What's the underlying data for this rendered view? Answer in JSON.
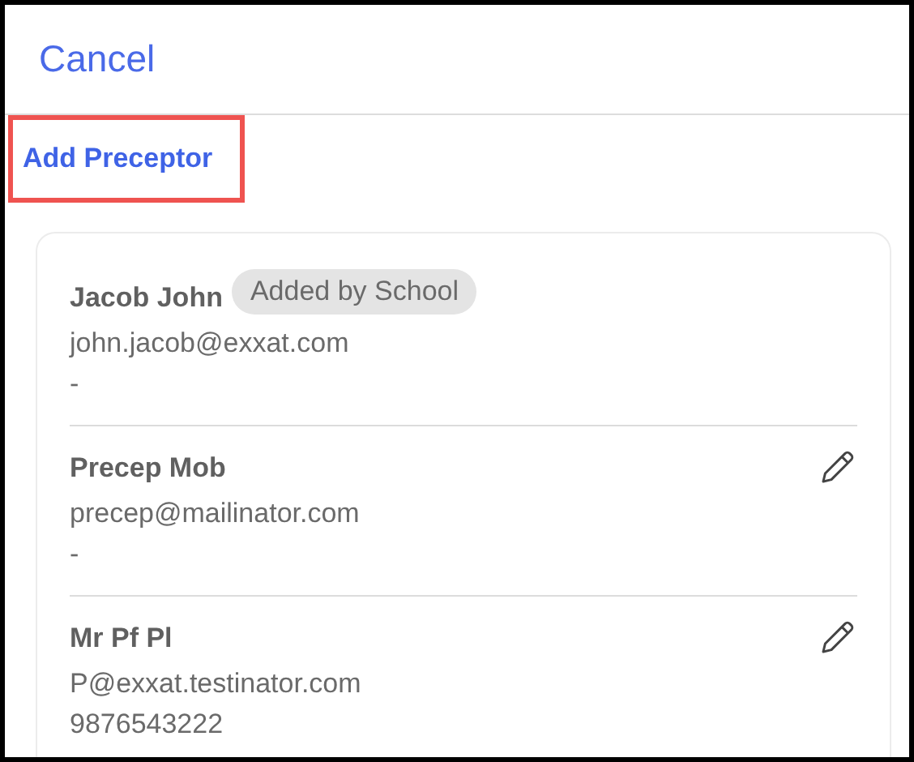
{
  "header": {
    "cancel": "Cancel"
  },
  "add_button": {
    "label": "Add Preceptor",
    "highlighted": true
  },
  "preceptors": [
    {
      "name": "Jacob John",
      "badge": "Added by School",
      "email": "john.jacob@exxat.com",
      "phone": "-",
      "editable": false
    },
    {
      "name": "Precep Mob",
      "email": "precep@mailinator.com",
      "phone": "-",
      "editable": true
    },
    {
      "name": "Mr Pf Pl",
      "email": "P@exxat.testinator.com",
      "phone": "9876543222",
      "editable": true
    }
  ]
}
